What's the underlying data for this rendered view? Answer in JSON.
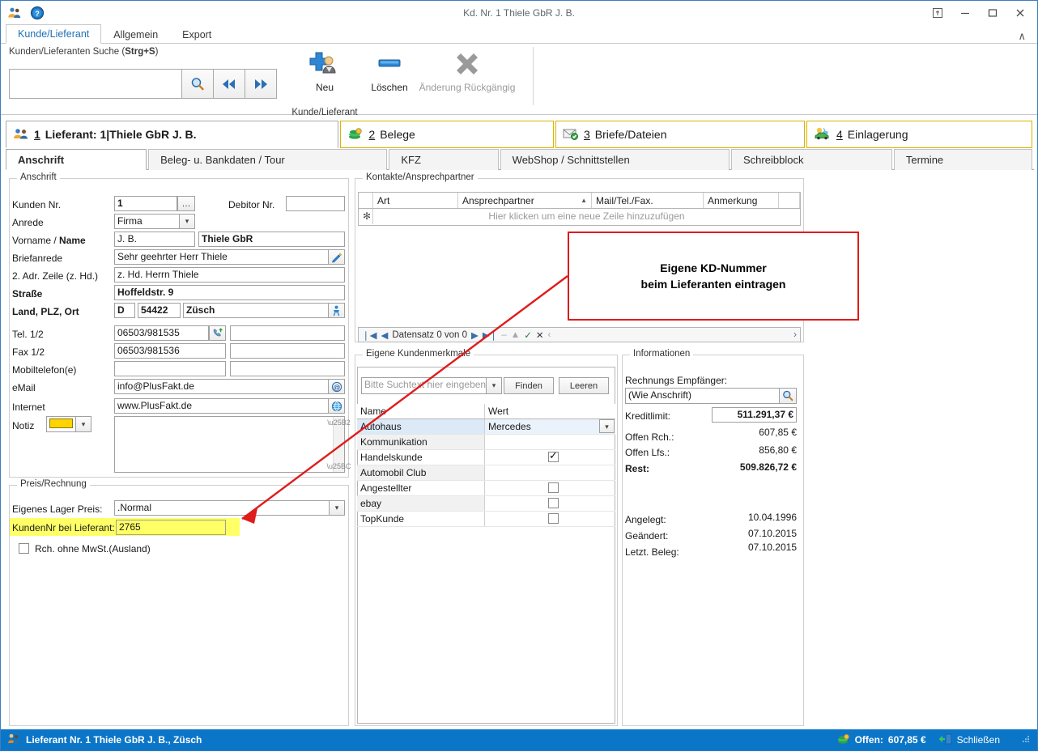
{
  "window": {
    "title": "Kd. Nr. 1 Thiele GbR J. B.",
    "qat": [
      {
        "name": "customers-icon",
        "glyph": "👥"
      },
      {
        "name": "help-icon",
        "glyph": "?"
      }
    ],
    "controls": {
      "pin": "⤒",
      "minimize": "–",
      "maximize": "☐",
      "close": "✕",
      "collapse_ribbon": "∧"
    }
  },
  "ribbon": {
    "tabs": [
      {
        "label": "Kunde/Lieferant",
        "active": true
      },
      {
        "label": "Allgemein",
        "active": false
      },
      {
        "label": "Export",
        "active": false
      }
    ],
    "search": {
      "label_plain": "Kunden/Lieferanten Suche (",
      "label_bold": "Strg+S",
      "label_tail": ")",
      "value": "",
      "placeholder": "",
      "buttons": [
        {
          "name": "search-button",
          "glyph": "🔍"
        },
        {
          "name": "prev-record-button",
          "glyph": "◀◀"
        },
        {
          "name": "next-record-button",
          "glyph": "▶▶"
        }
      ]
    },
    "group_caption": "Kunde/Lieferant",
    "commands": [
      {
        "name": "new-button",
        "label": "Neu",
        "enabled": true
      },
      {
        "name": "delete-button",
        "label": "Löschen",
        "enabled": true
      },
      {
        "name": "undo-change-button",
        "label": "Änderung Rückgängig",
        "enabled": false
      }
    ]
  },
  "doc_tabs": [
    {
      "num": "1",
      "label": " Lieferant: 1|Thiele GbR J. B.",
      "active": true,
      "icon": "supplier-icon"
    },
    {
      "num": "2",
      "label": " Belege",
      "active": false,
      "icon": "money-icon"
    },
    {
      "num": "3",
      "label": " Briefe/Dateien",
      "active": false,
      "icon": "mail-icon"
    },
    {
      "num": "4",
      "label": " Einlagerung",
      "active": false,
      "icon": "storage-car-icon"
    }
  ],
  "sub_tabs": [
    {
      "label": "Anschrift",
      "active": true
    },
    {
      "label": "Beleg- u. Bankdaten / Tour",
      "active": false
    },
    {
      "label": "KFZ",
      "active": false
    },
    {
      "label": "WebShop / Schnittstellen",
      "active": false
    },
    {
      "label": "Schreibblock",
      "active": false
    },
    {
      "label": "Termine",
      "active": false
    }
  ],
  "anschrift": {
    "caption": "Anschrift",
    "kunden_nr_label": "Kunden Nr.",
    "kunden_nr_value": "1",
    "kunden_nr_button": "…",
    "debitor_nr_label": "Debitor Nr.",
    "debitor_nr_value": "",
    "anrede_label": "Anrede",
    "anrede_value": "Firma",
    "vorname_name_label_1": "Vorname / ",
    "vorname_name_label_2": "Name",
    "vorname_value": "J. B.",
    "name_value": "Thiele GbR",
    "briefanrede_label": "Briefanrede",
    "briefanrede_value": "Sehr geehrter Herr Thiele",
    "adr2_label": "2. Adr. Zeile (z. Hd.)",
    "adr2_value": "z. Hd. Herrn Thiele",
    "strasse_label": "Straße",
    "strasse_value": "Hoffeldstr. 9",
    "land_plz_ort_label": "Land, PLZ, Ort",
    "land_value": "D",
    "plz_value": "54422",
    "ort_value": "Züsch",
    "tel_label": "Tel. 1/2",
    "tel1_value": "06503/981535",
    "tel2_value": "",
    "fax_label": "Fax 1/2",
    "fax1_value": "06503/981536",
    "fax2_value": "",
    "mobil_label": "Mobiltelefon(e)",
    "mobil1_value": "",
    "mobil2_value": "",
    "email_label": "eMail",
    "email_value": "info@PlusFakt.de",
    "internet_label": "Internet",
    "internet_value": "www.PlusFakt.de",
    "notiz_label": "Notiz",
    "notiz_color": "#ffd400",
    "notiz_value": ""
  },
  "preis_rechnung": {
    "caption": "Preis/Rechnung",
    "lager_preis_label": "Eigenes Lager Preis:",
    "lager_preis_value": ".Normal",
    "kundennr_label": "KundenNr bei Lieferant:",
    "kundennr_value": "2765",
    "highlight_color": "#ffff66",
    "mwst_label": "Rch. ohne MwSt.(Ausland)",
    "mwst_checked": false
  },
  "kontakte": {
    "caption": "Kontakte/Ansprechpartner",
    "columns": [
      "",
      "Art",
      "Ansprechpartner",
      "Mail/Tel./Fax.",
      "Anmerkung",
      ""
    ],
    "sorted_column": "Ansprechpartner",
    "sort_glyph": "▲",
    "new_row_marker": "✻",
    "new_row_hint": "Hier klicken um eine neue Zeile hinzuzufügen",
    "rows": [],
    "navigator": {
      "text": "Datensatz 0 von 0",
      "buttons": [
        "❘◀",
        "◀",
        "▶",
        "▶❘",
        "–",
        "▲",
        "✓",
        "✕",
        "‹"
      ],
      "expand": "›"
    }
  },
  "merkmale": {
    "caption": "Eigene Kundenmerkmale",
    "search_placeholder": "Bitte Suchtext hier eingeben..",
    "search_value": "",
    "find_button": "Finden",
    "clear_button": "Leeren",
    "columns": [
      "Name",
      "Wert"
    ],
    "rows": [
      {
        "name": "Autohaus",
        "type": "combo",
        "value": "Mercedes",
        "selected": true
      },
      {
        "name": "Kommunikation",
        "type": "text",
        "value": "",
        "selected": false
      },
      {
        "name": "Handelskunde",
        "type": "check",
        "checked": true,
        "selected": false
      },
      {
        "name": "Automobil Club",
        "type": "text",
        "value": "",
        "selected": false
      },
      {
        "name": "Angestellter",
        "type": "check",
        "checked": false,
        "selected": false
      },
      {
        "name": "ebay",
        "type": "check",
        "checked": false,
        "selected": false
      },
      {
        "name": "TopKunde",
        "type": "check",
        "checked": false,
        "selected": false
      }
    ]
  },
  "informationen": {
    "caption": "Informationen",
    "rechnungs_empfaenger_label": "Rechnungs Empfänger:",
    "rechnungs_empfaenger_value": "(Wie Anschrift)",
    "rows": [
      {
        "label": "Kreditlimit:",
        "value": "511.291,37 €",
        "bold": true,
        "framed": true
      },
      {
        "label": "Offen Rch.:",
        "value": "607,85 €",
        "bold": false,
        "framed": false
      },
      {
        "label": "Offen Lfs.:",
        "value": "856,80 €",
        "bold": false,
        "framed": false
      },
      {
        "label": "Rest:",
        "value": "509.826,72 €",
        "bold": true,
        "framed": false
      }
    ],
    "dates": [
      {
        "label": "Angelegt:",
        "value": "10.04.1996"
      },
      {
        "label": "Geändert:",
        "value": "07.10.2015"
      },
      {
        "label": "Letzt. Beleg:",
        "value": "07.10.2015"
      }
    ]
  },
  "annotation": {
    "line1": "Eigene KD-Nummer",
    "line2": "beim Lieferanten eintragen",
    "border_color": "#e01b1b",
    "arrow_color": "#e01b1b"
  },
  "statusbar": {
    "left_text": "Lieferant Nr. 1 Thiele GbR J. B., Züsch",
    "offen_label": "Offen:",
    "offen_value": "607,85 €",
    "close_label": "Schließen",
    "background": "#0b76c8"
  }
}
